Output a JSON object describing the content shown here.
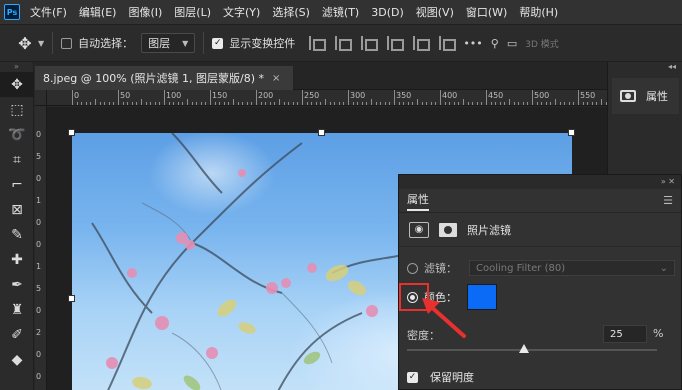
{
  "app": {
    "logo": "Ps"
  },
  "menu": [
    "文件(F)",
    "编辑(E)",
    "图像(I)",
    "图层(L)",
    "文字(Y)",
    "选择(S)",
    "滤镜(T)",
    "3D(D)",
    "视图(V)",
    "窗口(W)",
    "帮助(H)"
  ],
  "options": {
    "auto_select_label": "自动选择：",
    "auto_select_checked": false,
    "auto_select_value": "图层",
    "show_transform_label": "显示变换控件",
    "show_transform_checked": true,
    "mode_3d_label": "3D 模式"
  },
  "document": {
    "tab_title": "8.jpeg @ 100% (照片滤镜 1, 图层蒙版/8) *",
    "close": "×"
  },
  "ruler": {
    "top_labels": [
      "0",
      "50",
      "100",
      "150",
      "200",
      "250",
      "300",
      "350",
      "400",
      "450",
      "500",
      "550"
    ],
    "left_labels": [
      "0",
      "5",
      "0",
      "1",
      "0",
      "0",
      "1",
      "5",
      "0",
      "2",
      "0",
      "0"
    ]
  },
  "dock": {
    "properties_label": "属性"
  },
  "properties": {
    "title": "属性",
    "adjustment_label": "照片滤镜",
    "filter_label": "滤镜：",
    "filter_value": "Cooling Filter (80)",
    "filter_selected": false,
    "color_label": "颜色：",
    "color_selected": true,
    "color_value": "#0b6bf6",
    "density_label": "密度：",
    "density_value": "25",
    "density_unit": "%",
    "density_fraction": 0.25,
    "preserve_luminosity_label": "保留明度",
    "preserve_luminosity_checked": true
  },
  "annotation": {
    "highlight_color": "#e8302f"
  }
}
